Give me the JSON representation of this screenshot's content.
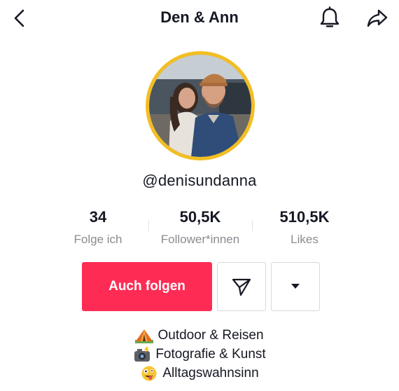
{
  "header": {
    "title": "Den & Ann",
    "back_icon": "chevron-left-icon",
    "bell_icon": "bell-icon",
    "share_icon": "share-icon"
  },
  "profile": {
    "username": "@denisundanna",
    "avatar_ring_color": "#f2be24"
  },
  "stats": [
    {
      "value": "34",
      "label": "Folge ich"
    },
    {
      "value": "50,5K",
      "label": "Follower*innen"
    },
    {
      "value": "510,5K",
      "label": "Likes"
    }
  ],
  "actions": {
    "follow_label": "Auch folgen",
    "follow_color": "#fe2c55",
    "message_icon": "send-icon",
    "more_icon": "caret-down-icon"
  },
  "bio": [
    {
      "emoji": "camping-tent-emoji",
      "text": "Outdoor & Reisen"
    },
    {
      "emoji": "camera-flash-emoji",
      "text": "Fotografie & Kunst"
    },
    {
      "emoji": "zany-face-emoji",
      "text": "Alltagswahnsinn"
    }
  ]
}
